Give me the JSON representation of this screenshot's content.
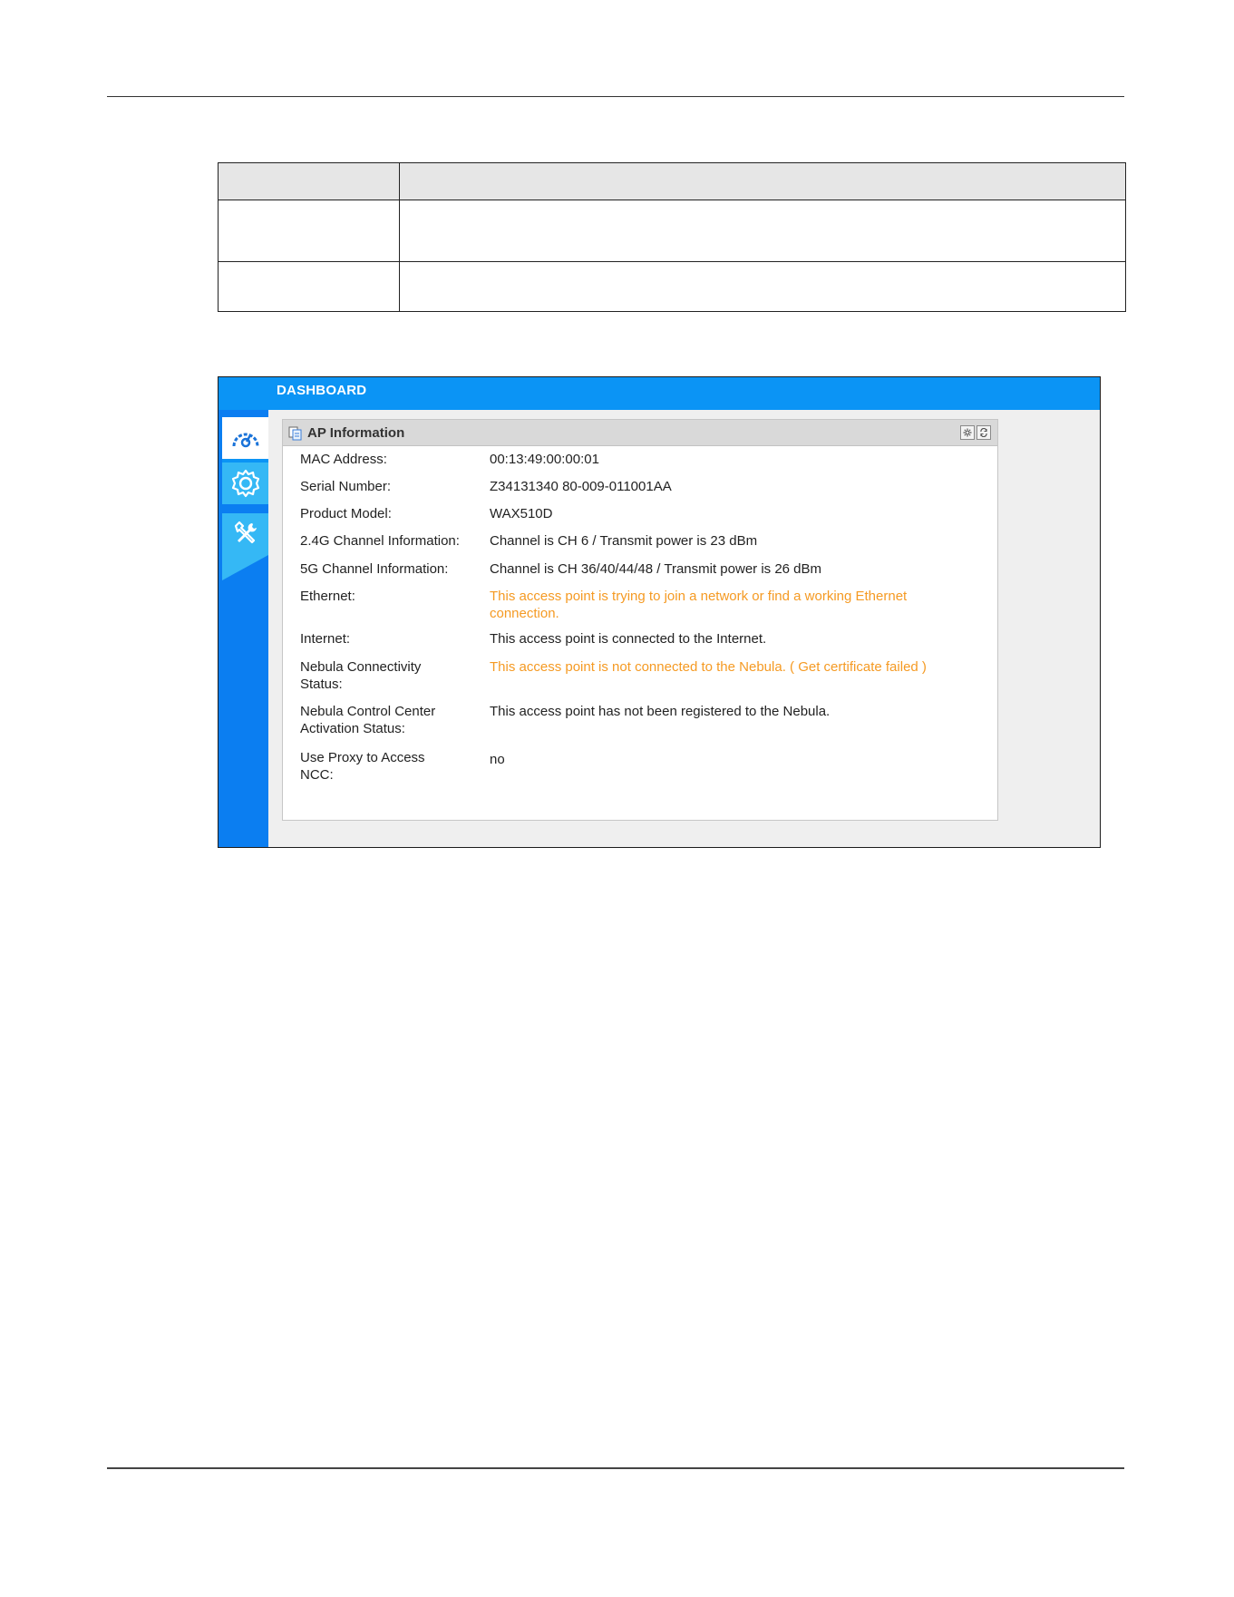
{
  "dashboard": {
    "title": "DASHBOARD",
    "nav": [
      {
        "icon": "dashboard-gauge-icon"
      },
      {
        "icon": "gear-icon"
      },
      {
        "icon": "tools-icon"
      }
    ]
  },
  "panel": {
    "title": "AP Information",
    "tools": [
      "settings-icon",
      "refresh-icon"
    ]
  },
  "info": {
    "mac_label": "MAC Address:",
    "mac_value": "00:13:49:00:00:01",
    "serial_label": "Serial Number:",
    "serial_value": "Z34131340 80-009-011001AA",
    "model_label": "Product Model:",
    "model_value": "WAX510D",
    "ch24_label": "2.4G Channel Information:",
    "ch24_value": "Channel is CH 6 / Transmit power is 23 dBm",
    "ch5_label": "5G Channel Information:",
    "ch5_value": "Channel is CH 36/40/44/48 / Transmit power is 26 dBm",
    "ethernet_label": "Ethernet:",
    "ethernet_value": "This access point is trying to join a network or find a working Ethernet connection.",
    "internet_label": "Internet:",
    "internet_value": "This access point is connected to the Internet.",
    "nebula_conn_label": "Nebula Connectivity Status:",
    "nebula_conn_value": "This access point is not connected to the Nebula. ( Get certificate failed )",
    "ncc_activation_label": "Nebula Control Center Activation Status:",
    "ncc_activation_value": "This access point has not been registered to the Nebula.",
    "proxy_label": "Use Proxy to Access NCC:",
    "proxy_value": "no"
  },
  "colors": {
    "topbar": "#0b94f5",
    "sidebar": "#0b7ef1",
    "warning_text": "#f59a23"
  }
}
